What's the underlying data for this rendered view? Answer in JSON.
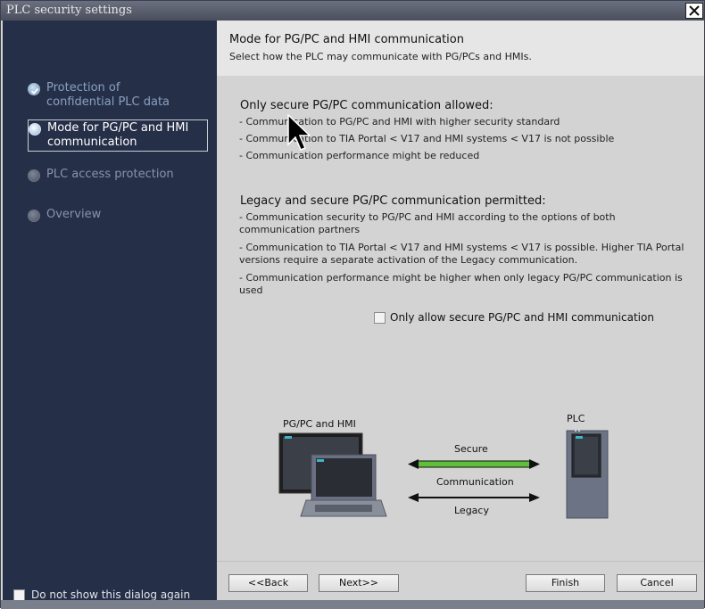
{
  "window": {
    "title": "PLC security settings",
    "close_icon": "close-icon"
  },
  "sidebar": {
    "steps": [
      {
        "label": "Protection of confidential PLC data",
        "state": "done"
      },
      {
        "label": "Mode for PG/PC and HMI communication",
        "state": "active"
      },
      {
        "label": "PLC access protection",
        "state": "pending"
      },
      {
        "label": "Overview",
        "state": "pending"
      }
    ],
    "dont_show_label": "Do not show this dialog again",
    "dont_show_checked": false
  },
  "header": {
    "title": "Mode for PG/PC and HMI communication",
    "subtitle": "Select how the PLC may communicate with PG/PCs and HMIs."
  },
  "content": {
    "section1": {
      "title": "Only secure PG/PC communication allowed:",
      "lines": [
        "- Communication to PG/PC and HMI with higher security standard",
        "- Communication to TIA Portal < V17 and HMI systems < V17 is not possible",
        "- Communication performance might be reduced"
      ]
    },
    "section2": {
      "title": "Legacy and secure PG/PC communication permitted:",
      "lines": [
        "- Communication security to PG/PC and HMI according to the options of both communication partners",
        "- Communication to TIA Portal < V17 and HMI systems < V17 is possible. Higher TIA Portal versions require a separate activation of the Legacy communication.",
        "- Communication performance might be higher when only legacy PG/PC communication is used"
      ]
    },
    "secure_only_checkbox": {
      "label": "Only allow secure PG/PC and HMI communication",
      "checked": false
    }
  },
  "diagram": {
    "left_label": "PG/PC and HMI",
    "right_label": "PLC",
    "secure_label": "Secure",
    "communication_label": "Communication",
    "legacy_label": "Legacy",
    "secure_color": "#5fbf3a"
  },
  "buttons": {
    "back": "<<Back",
    "next": "Next>>",
    "finish": "Finish",
    "cancel": "Cancel"
  }
}
